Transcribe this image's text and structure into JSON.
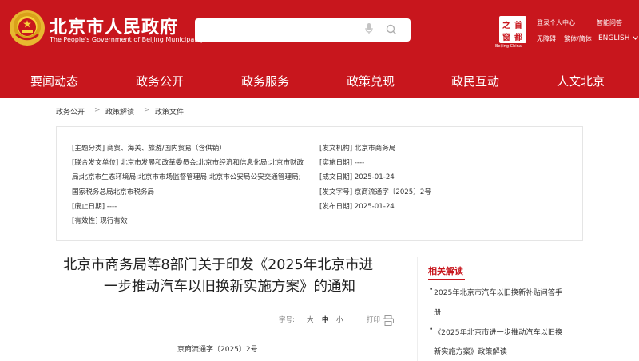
{
  "header": {
    "title": "北京市人民政府",
    "subtitle": "The People's Government of Beijing Municipality",
    "search": {
      "placeholder": ""
    },
    "seal": {
      "chars": [
        "首",
        "都",
        "之",
        "窗"
      ],
      "caption": "Beijing·China"
    },
    "links": {
      "login": "登录个人中心",
      "smart_qa": "智能问答",
      "accessible": "无障碍",
      "traditional": "繁体/简体",
      "english": "ENGLISH"
    }
  },
  "nav": [
    "要闻动态",
    "政务公开",
    "政务服务",
    "政策兑现",
    "政民互动",
    "人文北京"
  ],
  "breadcrumb": [
    "政务公开",
    "政策解读",
    "政策文件"
  ],
  "info": {
    "topic": "[主题分类] 商贸、海关、旅游/国内贸易（含供销）",
    "issuer": "[发文机构] 北京市商务局",
    "joint_line1": "[联合发文单位] 北京市发展和改革委员会;北京市经济和信息化局;北京市财政",
    "joint_line2": "局;北京市生态环境局;北京市市场监督管理局;北京市公安局公安交通管理局;",
    "joint_line3": "国家税务总局北京市税务局",
    "impl_date": "[实施日期] ----",
    "written_date": "[成文日期] 2025-01-24",
    "doc_no": "[发文字号] 京商流通字〔2025〕2号",
    "repeal_date": "[废止日期] ----",
    "publish_date": "[发布日期] 2025-01-24",
    "validity": "[有效性] 现行有效"
  },
  "article": {
    "title_line1": "北京市商务局等8部门关于印发《2025年北京市进",
    "title_line2": "一步推动汽车以旧换新实施方案》的通知",
    "font_size_label": "字号:",
    "font_sizes": [
      "大",
      "中",
      "小"
    ],
    "print_label": "打印",
    "doc_no": "京商流通字〔2025〕2号"
  },
  "related": {
    "heading": "相关解读",
    "items": [
      {
        "line1": "2025年北京市汽车以旧换新补贴问答手",
        "line2": "册"
      },
      {
        "line1": "《2025年北京市进一步推动汽车以旧换",
        "line2": "新实施方案》政策解读"
      }
    ]
  },
  "colors": {
    "brand_red": "#c8161d"
  },
  "icons": [
    "national-emblem-icon",
    "microphone-icon",
    "search-icon",
    "printer-icon"
  ]
}
